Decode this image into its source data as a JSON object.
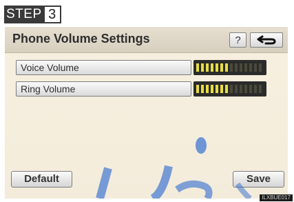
{
  "step": {
    "label": "STEP",
    "number": "3"
  },
  "header": {
    "title": "Phone Volume Settings",
    "help_label": "?",
    "back_icon": "back-arrow-icon"
  },
  "settings": [
    {
      "label": "Voice Volume",
      "level": 7,
      "max": 14
    },
    {
      "label": "Ring Volume",
      "level": 7,
      "max": 14
    }
  ],
  "footer": {
    "default_label": "Default",
    "save_label": "Save"
  },
  "image_code": "ILXBUE017",
  "colors": {
    "meter_on": "#e7dd45",
    "meter_off": "#4a4a3a",
    "meter_bg": "#2b2b2b",
    "screen_bg": "#f5eedd",
    "watermark": "#2f6cd1"
  }
}
